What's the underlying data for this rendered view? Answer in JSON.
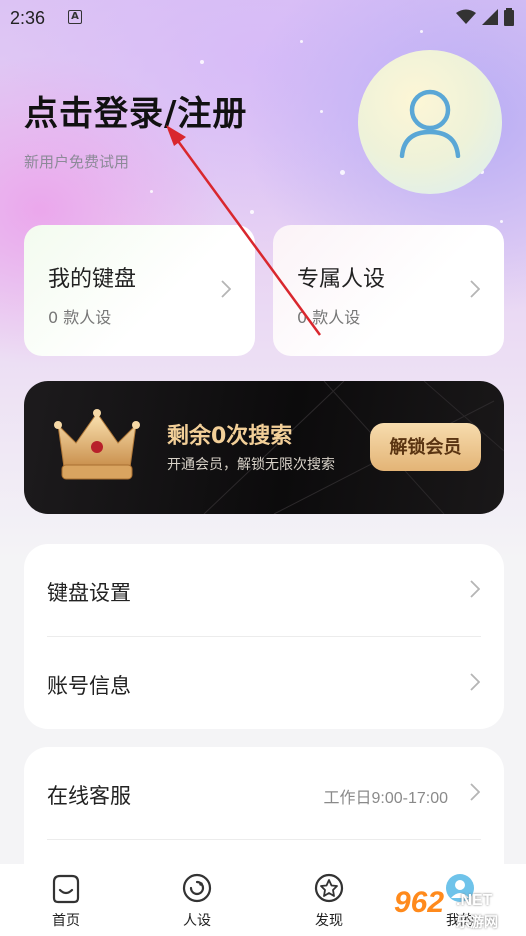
{
  "status_bar": {
    "time": "2:36",
    "notification_glyph": "A"
  },
  "header": {
    "login_title": "点击登录/注册",
    "login_subtitle": "新用户免费试用"
  },
  "cards": [
    {
      "title": "我的键盘",
      "subtitle": "0 款人设"
    },
    {
      "title": "专属人设",
      "subtitle": "0 款人设"
    }
  ],
  "vip_banner": {
    "title": "剩余0次搜索",
    "subtitle": "开通会员，解锁无限次搜索",
    "button_label": "解锁会员"
  },
  "menu_group_1": [
    {
      "label": "键盘设置"
    },
    {
      "label": "账号信息"
    }
  ],
  "menu_group_2": [
    {
      "label": "在线客服",
      "value": "工作日9:00-17:00"
    }
  ],
  "bottom_nav": [
    {
      "label": "首页",
      "icon": "home-icon"
    },
    {
      "label": "人设",
      "icon": "persona-icon"
    },
    {
      "label": "发现",
      "icon": "discover-icon"
    },
    {
      "label": "我的",
      "icon": "profile-icon"
    }
  ],
  "watermark": {
    "number": "962",
    "suffix": ".NET",
    "text": "乐游网"
  },
  "colors": {
    "vip_gold": "#f2cf98",
    "vip_button": "#e3b476",
    "annotation_arrow": "#d9272e",
    "avatar_icon": "#5aa7d6"
  }
}
